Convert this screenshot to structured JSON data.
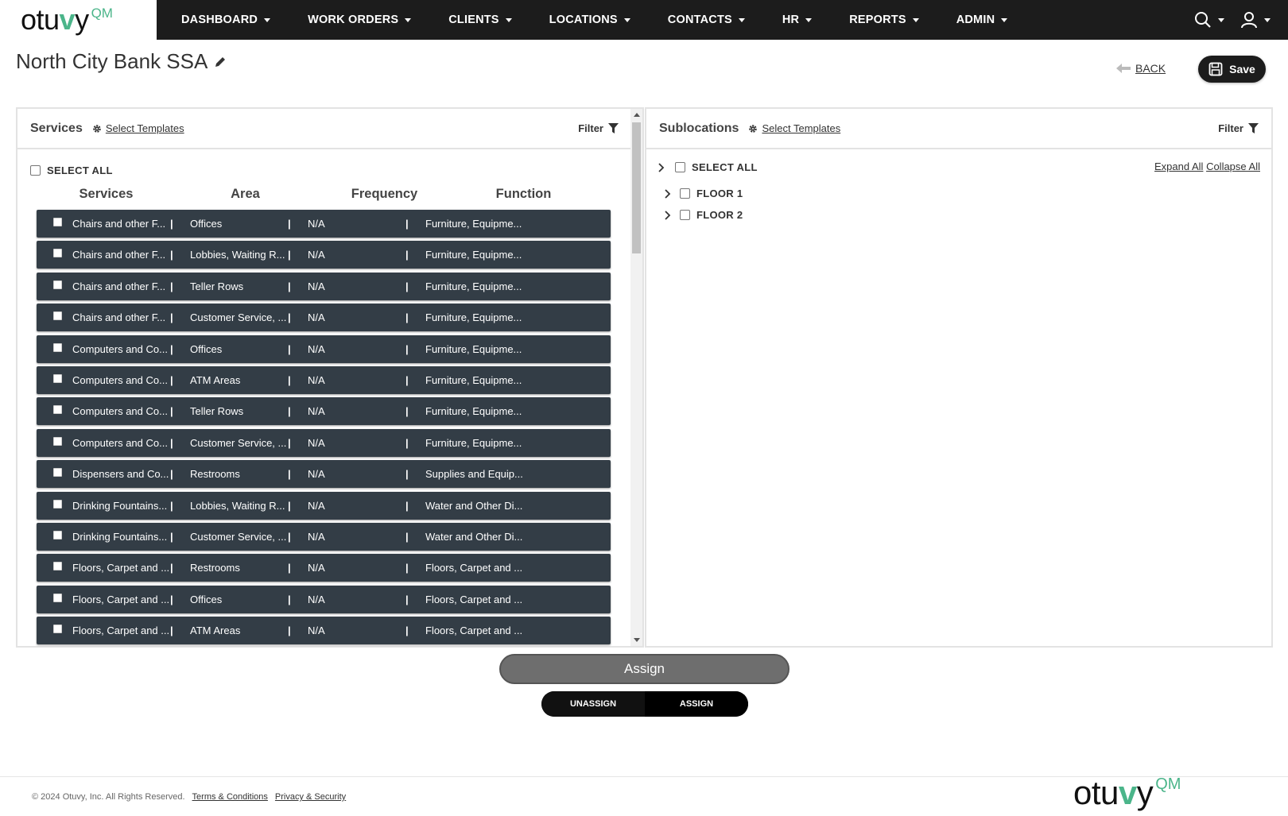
{
  "brand": {
    "logo_text_a": "otu",
    "logo_text_v": "v",
    "logo_text_b": "y",
    "logo_sup": "QM"
  },
  "nav": {
    "items": [
      "DASHBOARD",
      "WORK ORDERS",
      "CLIENTS",
      "LOCATIONS",
      "CONTACTS",
      "HR",
      "REPORTS",
      "ADMIN"
    ]
  },
  "page": {
    "title": "North City Bank SSA",
    "back_label": "BACK",
    "save_label": "Save"
  },
  "services": {
    "title": "Services",
    "select_templates": "Select Templates",
    "filter_label": "Filter",
    "select_all": "SELECT ALL",
    "columns": [
      "Services",
      "Area",
      "Frequency",
      "Function"
    ],
    "separator": "|",
    "rows": [
      [
        "Chairs and other F...",
        "Offices",
        "N/A",
        "Furniture, Equipme..."
      ],
      [
        "Chairs and other F...",
        "Lobbies, Waiting R...",
        "N/A",
        "Furniture, Equipme..."
      ],
      [
        "Chairs and other F...",
        "Teller Rows",
        "N/A",
        "Furniture, Equipme..."
      ],
      [
        "Chairs and other F...",
        "Customer Service, ...",
        "N/A",
        "Furniture, Equipme..."
      ],
      [
        "Computers and Co...",
        "Offices",
        "N/A",
        "Furniture, Equipme..."
      ],
      [
        "Computers and Co...",
        "ATM Areas",
        "N/A",
        "Furniture, Equipme..."
      ],
      [
        "Computers and Co...",
        "Teller Rows",
        "N/A",
        "Furniture, Equipme..."
      ],
      [
        "Computers and Co...",
        "Customer Service, ...",
        "N/A",
        "Furniture, Equipme..."
      ],
      [
        "Dispensers and Co...",
        "Restrooms",
        "N/A",
        "Supplies and Equip..."
      ],
      [
        "Drinking Fountains...",
        "Lobbies, Waiting R...",
        "N/A",
        "Water and Other Di..."
      ],
      [
        "Drinking Fountains...",
        "Customer Service, ...",
        "N/A",
        "Water and Other Di..."
      ],
      [
        "Floors, Carpet and ...",
        "Restrooms",
        "N/A",
        "Floors, Carpet and ..."
      ],
      [
        "Floors, Carpet and ...",
        "Offices",
        "N/A",
        "Floors, Carpet and ..."
      ],
      [
        "Floors, Carpet and ...",
        "ATM Areas",
        "N/A",
        "Floors, Carpet and ..."
      ]
    ]
  },
  "sublocations": {
    "title": "Sublocations",
    "select_templates": "Select Templates",
    "filter_label": "Filter",
    "select_all": "SELECT ALL",
    "expand_all": "Expand All",
    "collapse_all": "Collapse All",
    "nodes": [
      "FLOOR 1",
      "FLOOR 2"
    ]
  },
  "actions": {
    "assign_button": "Assign",
    "toggle_unassign": "UNASSIGN",
    "toggle_assign": "ASSIGN"
  },
  "footer": {
    "copyright": "© 2024 Otuvy, Inc. All Rights Reserved.",
    "terms": "Terms & Conditions",
    "privacy": "Privacy & Security"
  },
  "colors": {
    "nav_bg": "#1c1c1c",
    "row_bg": "#333d46",
    "brand_green": "#4bb58a"
  }
}
